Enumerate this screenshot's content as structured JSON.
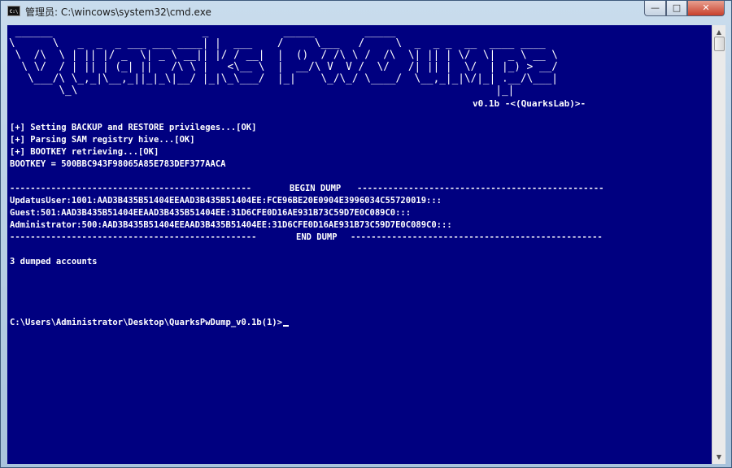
{
  "window": {
    "title": "管理员: C:\\wincows\\system32\\cmd.exe",
    "app_icon_text": "C:\\",
    "controls": {
      "minimize": "—",
      "maximize": "□",
      "close": "✕"
    }
  },
  "console": {
    "banner_ascii": " ______                        _            _____        _____\n\\      \\   _  _  _ ___ ___ ____| |  ___    /     \\___   /     \\  _  _ _  __  ____ ____\n \\  /\\  \\ | || |/ _  \\| _ \\ __|| |/ / __|  |  ()  / /\\ \\ /  /\\  \\| || | \\/  \\|  _ \\ __ \\\n  \\ \\/  / | || | (_| ||   /\\ \\ |   <\\__ \\  |  __/\\ V  V /  \\/   /| || |  \\/  | |_) > __/\n   \\___/\\ \\_,_|\\__,_||_|_\\|__/ |_|\\_\\___/  |_|    \\_/\\_/ \\____/  \\__,_|_|\\/|_| .__/\\___|\n        \\_\\                                                                   |_|",
    "version": "v0.1b -<(QuarksLab)>-",
    "lines": [
      "[+] Setting BACKUP and RESTORE privileges...[OK]",
      "[+] Parsing SAM registry hive...[OK]",
      "[+] BOOTKEY retrieving...[OK]",
      "BOOTKEY = 500BBC943F98065A85E783DEF377AACA"
    ],
    "begin_dump": "BEGIN DUMP",
    "dump_rows": [
      "UpdatusUser:1001:AAD3B435B51404EEAAD3B435B51404EE:FCE96BE20E0904E3996034C55720019:::",
      "Guest:501:AAD3B435B51404EEAAD3B435B51404EE:31D6CFE0D16AE931B73C59D7E0C089C0:::",
      "Administrator:500:AAD3B435B51404EEAAD3B435B51404EE:31D6CFE0D16AE931B73C59D7E0C089C0:::"
    ],
    "end_dump": "END DUMP",
    "summary": "3 dumped accounts",
    "prompt": "C:\\Users\\Administrator\\Desktop\\QuarksPwDump_v0.1b(1)>"
  }
}
